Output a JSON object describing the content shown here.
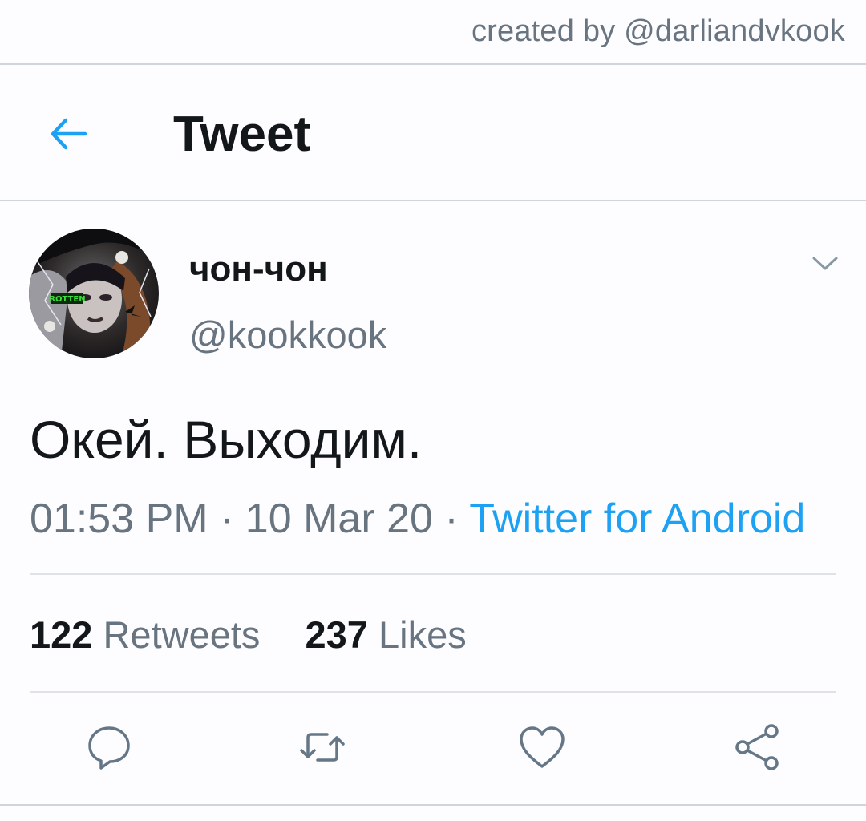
{
  "watermark": "created by @darliandvkook",
  "header": {
    "back_icon": "arrow-left-icon",
    "title": "Tweet"
  },
  "tweet": {
    "author": {
      "display_name": "чон-чон",
      "handle": "@kookkook",
      "avatar_badge": "ROTTEN"
    },
    "text": "Окей. Выходим.",
    "time": "01:53 PM",
    "separator": " · ",
    "date": "10 Mar 20",
    "source": "Twitter for Android",
    "stats": {
      "retweets_count": "122",
      "retweets_label": "Retweets",
      "likes_count": "237",
      "likes_label": "Likes"
    }
  },
  "actions": [
    {
      "icon": "reply-icon"
    },
    {
      "icon": "retweet-icon"
    },
    {
      "icon": "like-icon"
    },
    {
      "icon": "share-icon"
    }
  ],
  "colors": {
    "accent": "#1da1f2",
    "secondary_text": "#687480",
    "primary_text": "#14171a",
    "divider": "#cfd5db"
  }
}
